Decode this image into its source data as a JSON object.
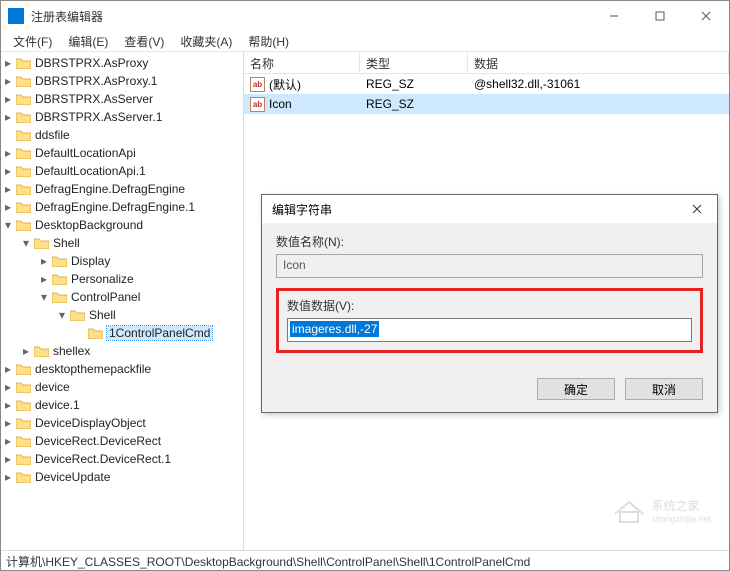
{
  "titlebar": {
    "title": "注册表编辑器"
  },
  "menubar": {
    "items": [
      "文件(F)",
      "编辑(E)",
      "查看(V)",
      "收藏夹(A)",
      "帮助(H)"
    ]
  },
  "tree": [
    {
      "depth": 0,
      "twisty": ">",
      "label": "DBRSTPRX.AsProxy"
    },
    {
      "depth": 0,
      "twisty": ">",
      "label": "DBRSTPRX.AsProxy.1"
    },
    {
      "depth": 0,
      "twisty": ">",
      "label": "DBRSTPRX.AsServer"
    },
    {
      "depth": 0,
      "twisty": ">",
      "label": "DBRSTPRX.AsServer.1"
    },
    {
      "depth": 0,
      "twisty": "",
      "label": "ddsfile"
    },
    {
      "depth": 0,
      "twisty": ">",
      "label": "DefaultLocationApi"
    },
    {
      "depth": 0,
      "twisty": ">",
      "label": "DefaultLocationApi.1"
    },
    {
      "depth": 0,
      "twisty": ">",
      "label": "DefragEngine.DefragEngine"
    },
    {
      "depth": 0,
      "twisty": ">",
      "label": "DefragEngine.DefragEngine.1"
    },
    {
      "depth": 0,
      "twisty": "v",
      "label": "DesktopBackground"
    },
    {
      "depth": 1,
      "twisty": "v",
      "label": "Shell"
    },
    {
      "depth": 2,
      "twisty": ">",
      "label": "Display"
    },
    {
      "depth": 2,
      "twisty": ">",
      "label": "Personalize"
    },
    {
      "depth": 2,
      "twisty": "v",
      "label": "ControlPanel"
    },
    {
      "depth": 3,
      "twisty": "v",
      "label": "Shell"
    },
    {
      "depth": 4,
      "twisty": "",
      "label": "1ControlPanelCmd",
      "selected": true
    },
    {
      "depth": 1,
      "twisty": ">",
      "label": "shellex"
    },
    {
      "depth": 0,
      "twisty": ">",
      "label": "desktopthemepackfile"
    },
    {
      "depth": 0,
      "twisty": ">",
      "label": "device"
    },
    {
      "depth": 0,
      "twisty": ">",
      "label": "device.1"
    },
    {
      "depth": 0,
      "twisty": ">",
      "label": "DeviceDisplayObject"
    },
    {
      "depth": 0,
      "twisty": ">",
      "label": "DeviceRect.DeviceRect"
    },
    {
      "depth": 0,
      "twisty": ">",
      "label": "DeviceRect.DeviceRect.1"
    },
    {
      "depth": 0,
      "twisty": ">",
      "label": "DeviceUpdate"
    }
  ],
  "list": {
    "cols": {
      "name": "名称",
      "type": "类型",
      "data": "数据"
    },
    "rows": [
      {
        "name": "(默认)",
        "type": "REG_SZ",
        "data": "@shell32.dll,-31061",
        "selected": false
      },
      {
        "name": "Icon",
        "type": "REG_SZ",
        "data": "",
        "selected": true
      }
    ]
  },
  "dialog": {
    "title": "编辑字符串",
    "name_label": "数值名称(N):",
    "name_value": "Icon",
    "data_label": "数值数据(V):",
    "data_value": "imageres.dll,-27",
    "ok": "确定",
    "cancel": "取消"
  },
  "statusbar": "计算机\\HKEY_CLASSES_ROOT\\DesktopBackground\\Shell\\ControlPanel\\Shell\\1ControlPanelCmd",
  "watermark": {
    "line1": "系统之家",
    "line2": "xitongzhijia.net"
  }
}
